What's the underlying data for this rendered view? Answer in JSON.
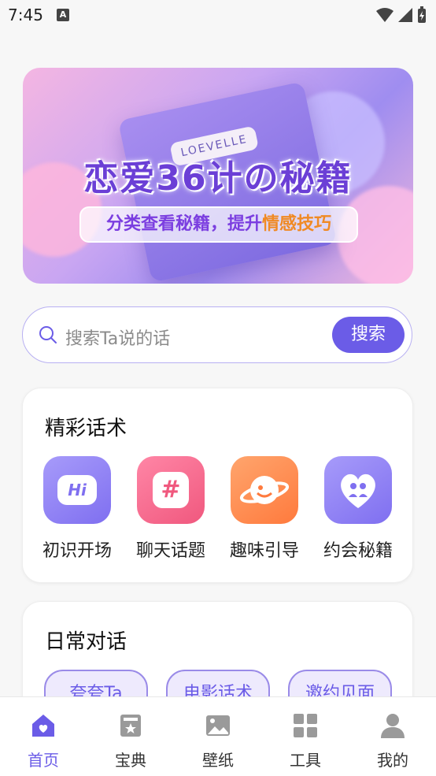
{
  "status": {
    "time": "7:45"
  },
  "banner": {
    "book_label": "LOEVELLE",
    "title": "恋爱36计の秘籍",
    "subtitle_a": "分类查看秘籍，提升",
    "subtitle_b": "情感技巧"
  },
  "search": {
    "placeholder": "搜索Ta说的话",
    "button": "搜索"
  },
  "featured": {
    "title": "精彩话术",
    "items": [
      {
        "label": "初识开场",
        "icon": "hi-icon",
        "glyph": "Hi"
      },
      {
        "label": "聊天话题",
        "icon": "hashtag-icon",
        "glyph": "#"
      },
      {
        "label": "趣味引导",
        "icon": "planet-icon",
        "glyph": ""
      },
      {
        "label": "约会秘籍",
        "icon": "couple-heart-icon",
        "glyph": ""
      }
    ]
  },
  "daily": {
    "title": "日常对话",
    "chips": [
      "夸夸Ta",
      "电影话术",
      "邀约见面"
    ]
  },
  "tabs": [
    {
      "label": "首页",
      "icon": "home-icon"
    },
    {
      "label": "宝典",
      "icon": "book-icon"
    },
    {
      "label": "壁纸",
      "icon": "image-icon"
    },
    {
      "label": "工具",
      "icon": "grid-icon"
    },
    {
      "label": "我的",
      "icon": "profile-icon"
    }
  ],
  "colors": {
    "accent": "#6b5ce7",
    "highlight": "#f08a24"
  }
}
